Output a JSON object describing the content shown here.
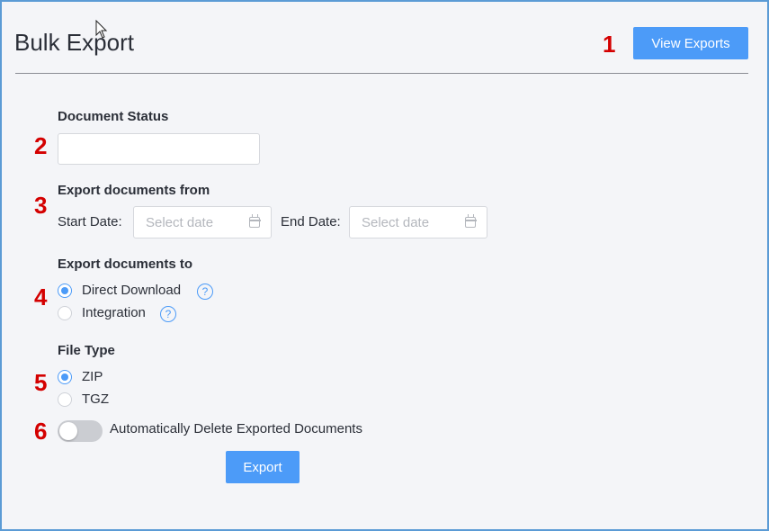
{
  "page": {
    "title": "Bulk Export",
    "view_exports_label": "View Exports"
  },
  "steps": [
    "1",
    "2",
    "3",
    "4",
    "5",
    "6"
  ],
  "document_status": {
    "label": "Document Status",
    "value": ""
  },
  "export_from": {
    "label": "Export documents from",
    "start_label": "Start Date:",
    "start_placeholder": "Select date",
    "end_label": "End Date:",
    "end_placeholder": "Select date"
  },
  "export_to": {
    "label": "Export documents to",
    "options": [
      {
        "label": "Direct Download",
        "selected": true,
        "help": "?"
      },
      {
        "label": "Integration",
        "selected": false,
        "help": "?"
      }
    ]
  },
  "file_type": {
    "label": "File Type",
    "options": [
      {
        "label": "ZIP",
        "selected": true
      },
      {
        "label": "TGZ",
        "selected": false
      }
    ]
  },
  "auto_delete": {
    "label": "Automatically Delete Exported Documents",
    "enabled": false
  },
  "export_button_label": "Export",
  "colors": {
    "accent": "#4c9bf8",
    "step_number": "#d40000",
    "frame_border": "#5b9bd5"
  }
}
